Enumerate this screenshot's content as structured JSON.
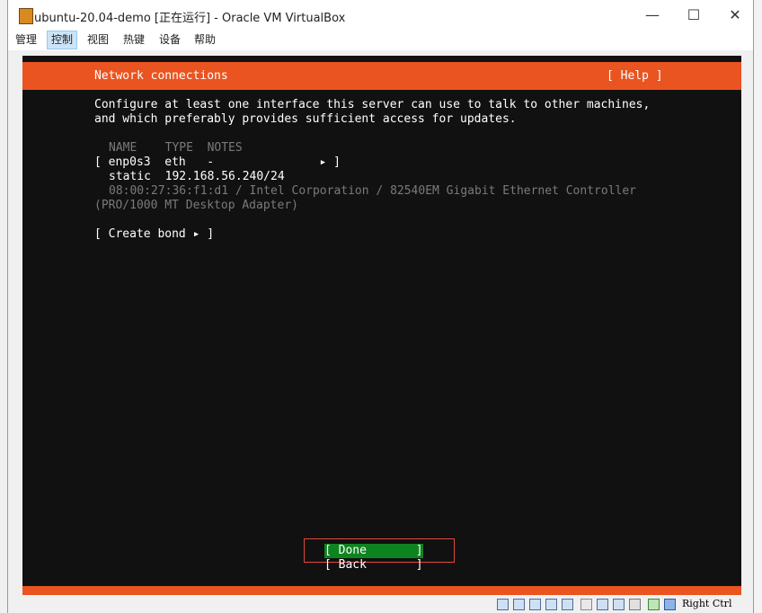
{
  "window": {
    "title": "ubuntu-20.04-demo [正在运行] - Oracle VM VirtualBox",
    "minimize": "—",
    "maximize": "☐",
    "close": "✕"
  },
  "menubar": [
    "管理",
    "控制",
    "视图",
    "热键",
    "设备",
    "帮助"
  ],
  "menubar_active_index": 1,
  "installer": {
    "header_title": "Network connections",
    "help": "[ Help ]",
    "intro_line1": "Configure at least one interface this server can use to talk to other machines,",
    "intro_line2": "and which preferably provides sufficient access for updates.",
    "table_header": "NAME    TYPE  NOTES",
    "iface_row": "[ enp0s3  eth   -               ▸ ]",
    "addr_row": "static  192.168.56.240/24",
    "mac_line1": "08:00:27:36:f1:d1 / Intel Corporation / 82540EM Gigabit Ethernet Controller",
    "mac_line2": "(PRO/1000 MT Desktop Adapter)",
    "create_bond": "[ Create bond ▸ ]",
    "done": "[ Done       ]",
    "back": "[ Back       ]"
  },
  "statusbar": {
    "host_key": "Right Ctrl",
    "icons": [
      "hard-disk-icon",
      "optical-drive-icon",
      "audio-icon",
      "network-icon",
      "usb-icon",
      "shared-folders-icon",
      "display-icon",
      "video-capture-icon",
      "cpu-icon",
      "mouse-integration-icon",
      "keyboard-icon"
    ]
  },
  "colors": {
    "ubuntu_orange": "#e95420",
    "done_green": "#0e8420",
    "terminal_bg": "#111111"
  }
}
